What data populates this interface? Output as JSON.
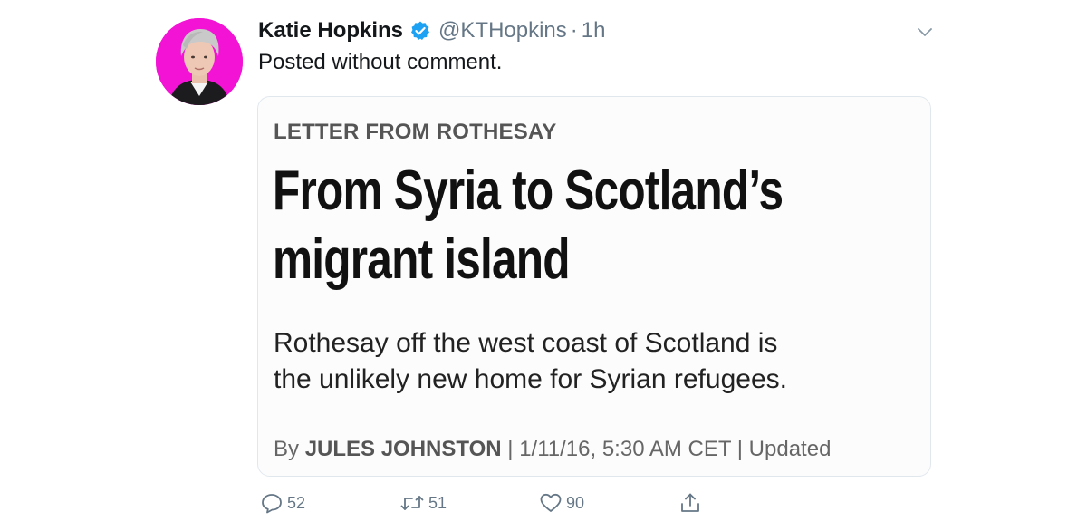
{
  "tweet": {
    "display_name": "Katie Hopkins",
    "verified_icon": "verified-badge-icon",
    "handle": "@KTHopkins",
    "separator": "·",
    "time": "1h",
    "text": "Posted without comment.",
    "avatar_bg": "#f213d4"
  },
  "card": {
    "kicker": "LETTER FROM ROTHESAY",
    "headline": [
      "From Syria to Scotland’s",
      "migrant island"
    ],
    "summary": [
      "Rothesay off the west coast of Scotland is",
      "the unlikely new home for Syrian refugees."
    ],
    "byline_prefix": "By ",
    "author": "JULES JOHNSTON",
    "byline_rest": " | 1/11/16, 5:30 AM CET | Updated"
  },
  "actions": {
    "reply_count": "52",
    "retweet_count": "51",
    "like_count": "90",
    "share_icon": "share-icon"
  },
  "colors": {
    "text": "#14171a",
    "secondary": "#657786",
    "verified": "#1da1f2",
    "border": "#e1e8ed"
  }
}
